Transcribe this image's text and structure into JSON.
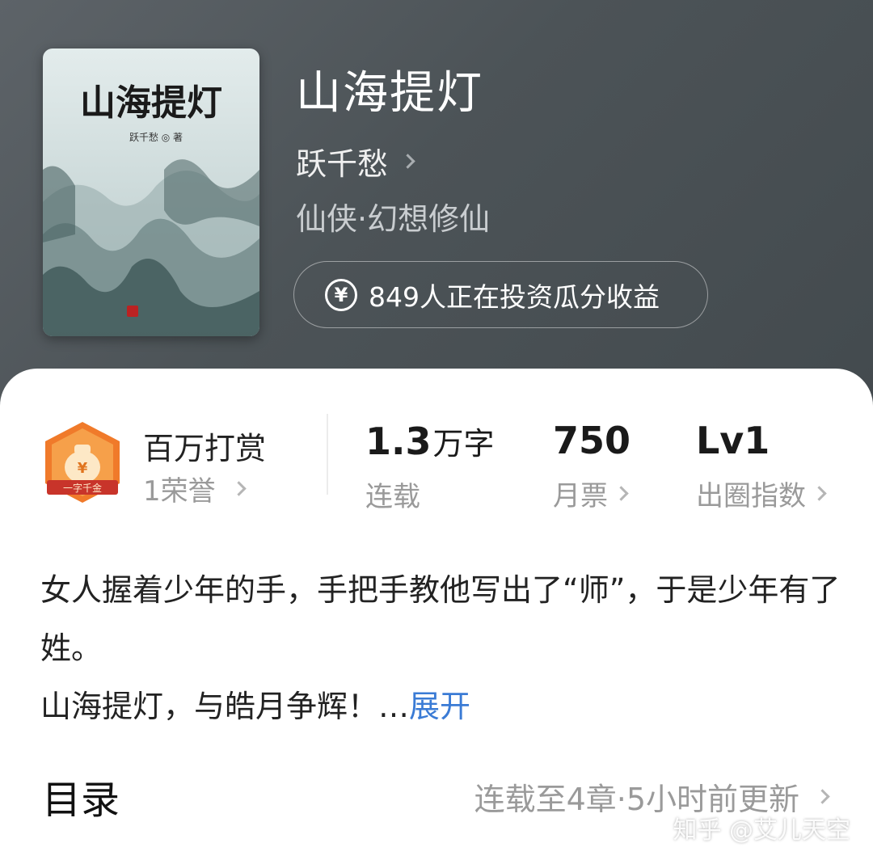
{
  "book": {
    "title": "山海提灯",
    "author": "跃千愁",
    "genre": "仙侠·幻想修仙",
    "invest_text": "849人正在投资瓜分收益",
    "invest_icon": "yen-coin-icon",
    "cover": {
      "title": "山海提灯",
      "author_line": "跃千愁 ◎ 著"
    }
  },
  "stats": {
    "reward": {
      "title": "百万打赏",
      "sub": "1荣誉",
      "badge_text": "一字千金",
      "badge_icon": "money-bag-icon"
    },
    "words": {
      "value": "1.3",
      "unit": "万字",
      "label": "连载"
    },
    "monthly_tickets": {
      "value": "750",
      "label": "月票"
    },
    "breakout": {
      "value": "Lv1",
      "label": "出圈指数"
    }
  },
  "synopsis": {
    "line1": "女人握着少年的手，手把手教他写出了“师”，于是少年有了姓。",
    "line2": "山海提灯，与皓月争辉！",
    "ellipsis": "…",
    "expand": "展开"
  },
  "toc": {
    "title": "目录",
    "status": "连载至4章·5小时前更新"
  },
  "watermark": "知乎 @艾儿天空",
  "colors": {
    "header_bg": "#4c5357",
    "accent_blue": "#3a7bd5",
    "badge_orange": "#f07a2a",
    "badge_red": "#c8342a"
  }
}
